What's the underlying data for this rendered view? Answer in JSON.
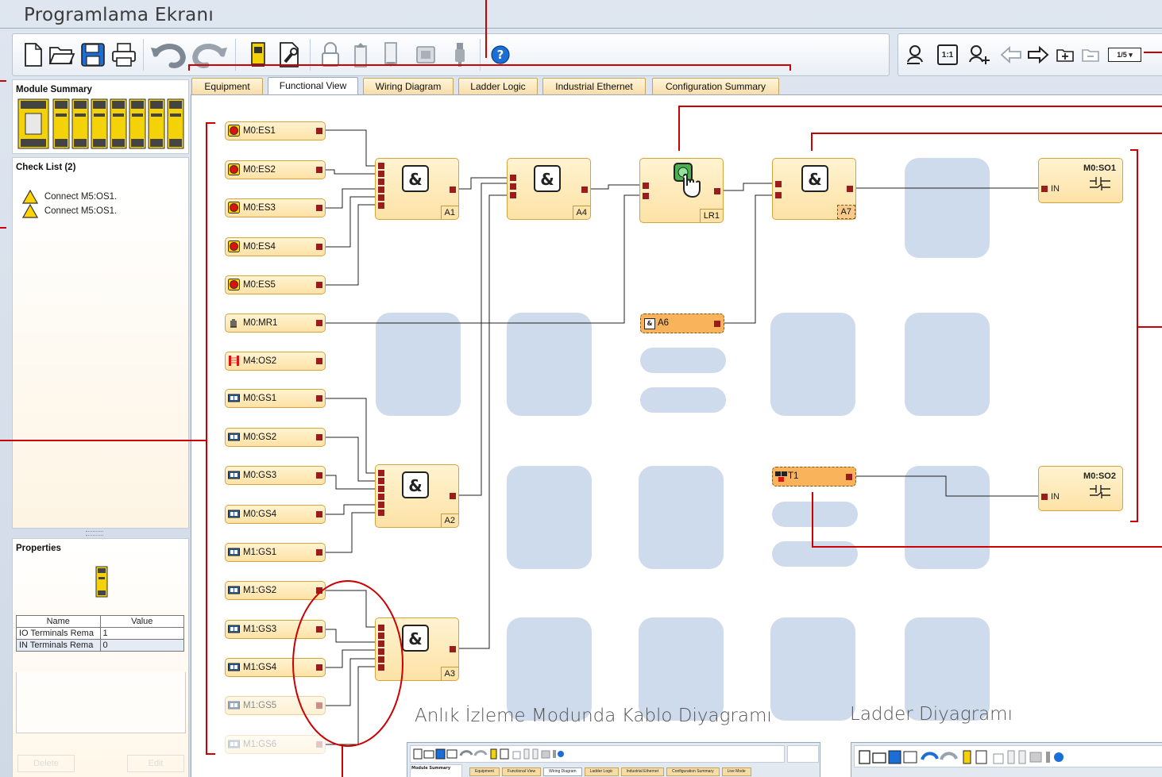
{
  "title": "Programlama Ekranı",
  "toolbar": {
    "icons": [
      "new-file-icon",
      "open-folder-icon",
      "save-icon",
      "print-icon",
      "undo-icon",
      "redo-icon",
      "module-icon",
      "settings-icon",
      "lock-icon",
      "upload-icon",
      "download-icon",
      "device-icon",
      "usb-icon",
      "help-icon"
    ],
    "zoom": {
      "fit_label": "1:1",
      "page_label": "1/5 ▾"
    }
  },
  "sidebar": {
    "module_summary": "Module Summary",
    "check_list": {
      "title": "Check List (2)",
      "items": [
        "Connect M5:OS1.",
        "Connect M5:OS1."
      ]
    },
    "properties": {
      "title": "Properties",
      "headers": [
        "Name",
        "Value"
      ],
      "rows": [
        [
          "IO Terminals Rema",
          "1"
        ],
        [
          "IN Terminals Rema",
          "0"
        ]
      ],
      "delete_label": "Delete",
      "edit_label": "Edit"
    }
  },
  "tabs": [
    "Equipment",
    "Functional View",
    "Wiring Diagram",
    "Ladder Logic",
    "Industrial Ethernet",
    "Configuration Summary"
  ],
  "active_tab": "Functional View",
  "inputs": [
    "M0:ES1",
    "M0:ES2",
    "M0:ES3",
    "M0:ES4",
    "M0:ES5",
    "M0:MR1",
    "M4:OS2",
    "M0:GS1",
    "M0:GS2",
    "M0:GS3",
    "M0:GS4",
    "M1:GS1",
    "M1:GS2",
    "M1:GS3",
    "M1:GS4",
    "M1:GS5",
    "M1:GS6"
  ],
  "gates": {
    "a1": "A1",
    "a2": "A2",
    "a3": "A3",
    "a4": "A4",
    "a6": "A6",
    "a7": "A7",
    "lr1": "LR1",
    "t1": "T1",
    "amp": "&"
  },
  "outputs": [
    {
      "name": "M0:SO1",
      "pin": "IN"
    },
    {
      "name": "M0:SO2",
      "pin": "IN"
    }
  ],
  "captions": {
    "live": "Anlık İzleme Modunda Kablo Diyagramı",
    "ladder": "Ladder Diyagramı"
  },
  "mini_tabs": [
    "Equipment",
    "Functional View",
    "Wiring Diagram",
    "Ladder Logic",
    "Industrial Ethernet",
    "Configuration Summary",
    "Live Mode"
  ],
  "mini_title": "Module Summary",
  "colors": {
    "accent": "#cc0000",
    "pin": "#9b1c1c",
    "block_fill": "#fde2a6",
    "selected_fill": "#f9b35a",
    "ghost": "#c9d7ea"
  }
}
